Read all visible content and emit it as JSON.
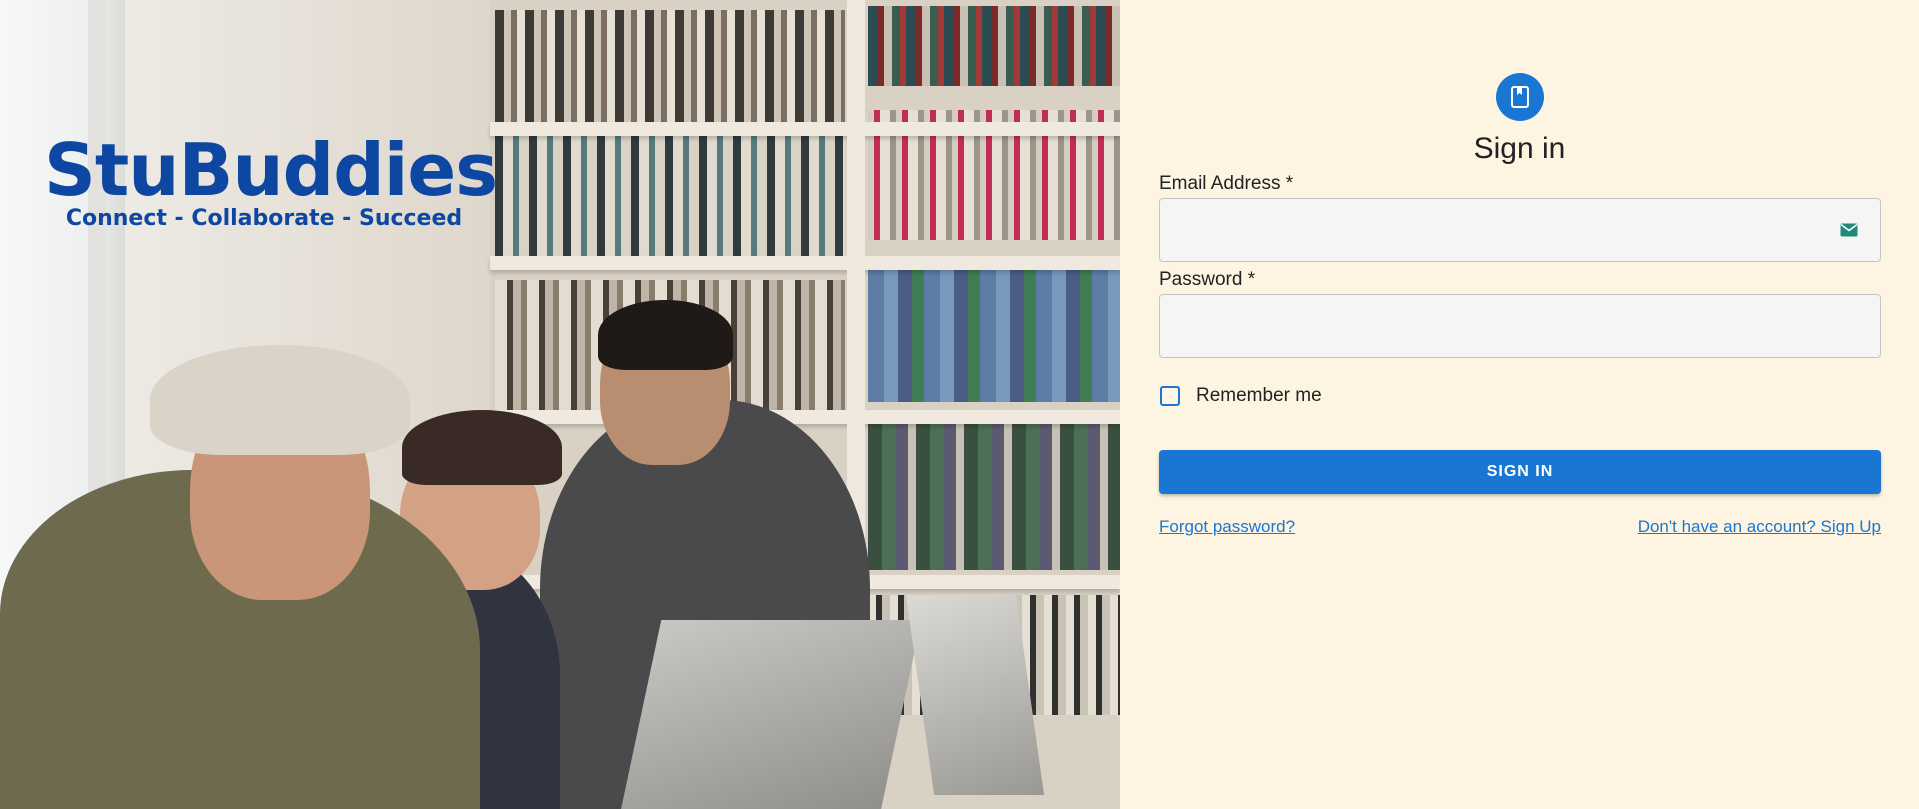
{
  "brand": {
    "name": "StuBuddies",
    "tagline": "Connect - Collaborate - Succeed"
  },
  "form": {
    "title": "Sign in",
    "email_label": "Email Address *",
    "email_value": "",
    "password_label": "Password *",
    "password_value": "",
    "remember_label": "Remember me",
    "remember_checked": false,
    "submit_label": "SIGN IN",
    "forgot_link": "Forgot password?",
    "signup_link": "Don't have an account? Sign Up"
  },
  "icons": {
    "avatar": "book-icon",
    "email_field": "mail-icon"
  },
  "colors": {
    "brand": "#0d47a1",
    "accent": "#1976d2",
    "panel_background": "#fdf5e2"
  }
}
